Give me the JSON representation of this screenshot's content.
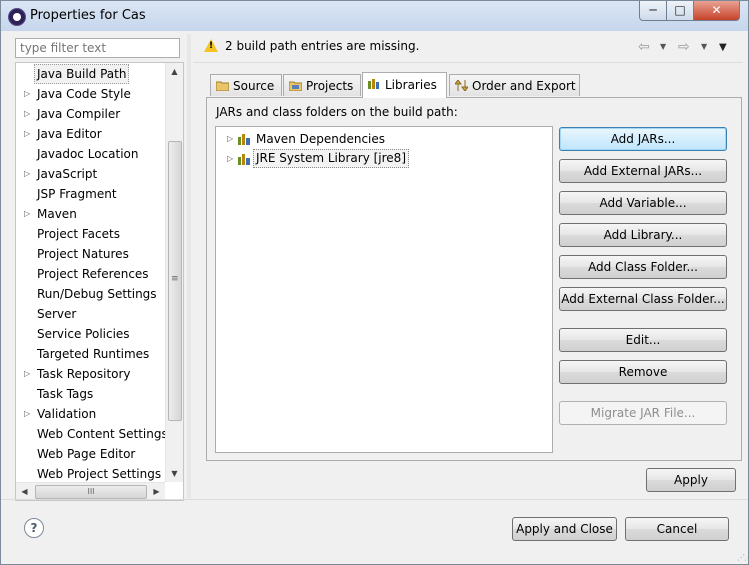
{
  "window": {
    "title": "Properties for Cas",
    "controls": {
      "minimize": "─",
      "maximize": "□",
      "close": "✕"
    }
  },
  "filter": {
    "placeholder": "type filter text"
  },
  "tree": {
    "items": [
      {
        "label": "Java Build Path",
        "expandable": false,
        "selected": true
      },
      {
        "label": "Java Code Style",
        "expandable": true
      },
      {
        "label": "Java Compiler",
        "expandable": true
      },
      {
        "label": "Java Editor",
        "expandable": true
      },
      {
        "label": "Javadoc Location",
        "expandable": false
      },
      {
        "label": "JavaScript",
        "expandable": true
      },
      {
        "label": "JSP Fragment",
        "expandable": false
      },
      {
        "label": "Maven",
        "expandable": true
      },
      {
        "label": "Project Facets",
        "expandable": false
      },
      {
        "label": "Project Natures",
        "expandable": false
      },
      {
        "label": "Project References",
        "expandable": false
      },
      {
        "label": "Run/Debug Settings",
        "expandable": false
      },
      {
        "label": "Server",
        "expandable": false
      },
      {
        "label": "Service Policies",
        "expandable": false
      },
      {
        "label": "Targeted Runtimes",
        "expandable": false
      },
      {
        "label": "Task Repository",
        "expandable": true
      },
      {
        "label": "Task Tags",
        "expandable": false
      },
      {
        "label": "Validation",
        "expandable": true
      },
      {
        "label": "Web Content Settings",
        "expandable": false
      },
      {
        "label": "Web Page Editor",
        "expandable": false
      },
      {
        "label": "Web Project Settings",
        "expandable": false
      }
    ]
  },
  "header": {
    "message": "2 build path entries are missing."
  },
  "tabs": [
    {
      "label": "Source",
      "active": false
    },
    {
      "label": "Projects",
      "active": false
    },
    {
      "label": "Libraries",
      "active": true
    },
    {
      "label": "Order and Export",
      "active": false
    }
  ],
  "libraries": {
    "section_label": "JARs and class folders on the build path:",
    "entries": [
      {
        "label": "Maven Dependencies",
        "selected": false
      },
      {
        "label": "JRE System Library [jre8]",
        "selected": true
      }
    ]
  },
  "buttons": {
    "add_jars": "Add JARs...",
    "add_external_jars": "Add External JARs...",
    "add_variable": "Add Variable...",
    "add_library": "Add Library...",
    "add_class_folder": "Add Class Folder...",
    "add_external_class_folder": "Add External Class Folder...",
    "edit": "Edit...",
    "remove": "Remove",
    "migrate_jar": "Migrate JAR File...",
    "apply": "Apply",
    "apply_and_close": "Apply and Close",
    "cancel": "Cancel"
  },
  "colors": {
    "window_bg": "#f0f0f0",
    "warning": "#f5c423",
    "default_button_border": "#3c7fb1"
  }
}
